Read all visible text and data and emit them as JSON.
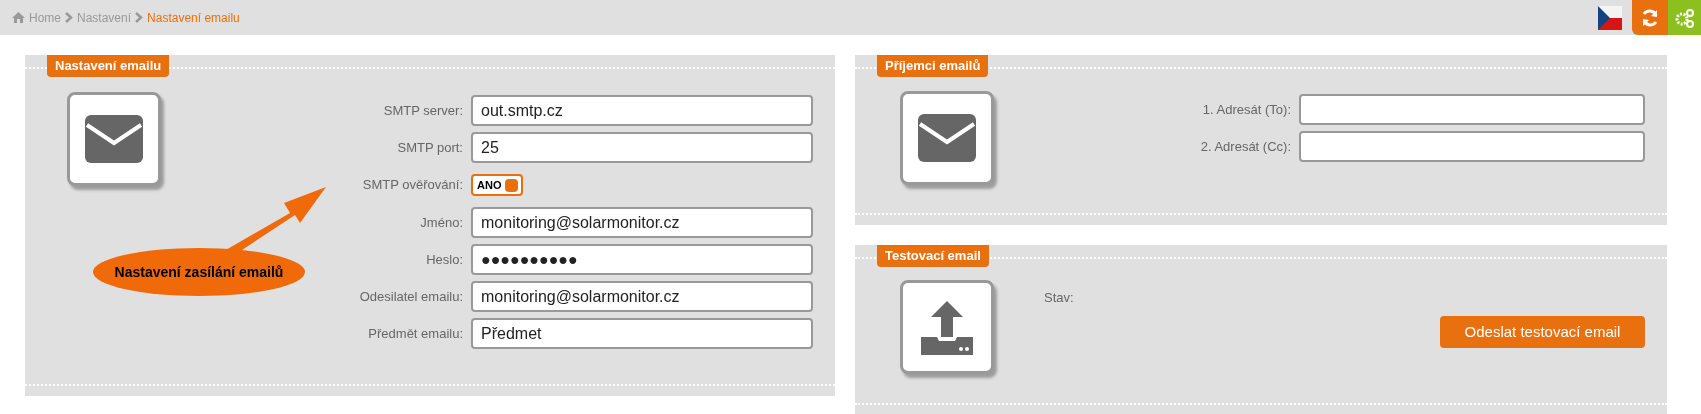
{
  "breadcrumb": [
    {
      "label": "Home",
      "selected": false
    },
    {
      "label": "Nastavení",
      "selected": false
    },
    {
      "label": "Nastavení emailu",
      "selected": true
    }
  ],
  "email_settings": {
    "title": "Nastavení emailu",
    "fields": [
      {
        "kind": "text",
        "label": "SMTP server:",
        "value": "out.smtp.cz"
      },
      {
        "kind": "text",
        "label": "SMTP port:",
        "value": "25"
      },
      {
        "kind": "toggle",
        "label": "SMTP ověřování:",
        "value": "ANO",
        "on": true
      },
      {
        "kind": "text",
        "label": "Jméno:",
        "value": "monitoring@solarmonitor.cz"
      },
      {
        "kind": "password",
        "label": "Heslo:",
        "value": "●●●●●●●●●●"
      },
      {
        "kind": "text",
        "label": "Odesilatel emailu:",
        "value": "monitoring@solarmonitor.cz"
      },
      {
        "kind": "text",
        "label": "Předmět emailu:",
        "value": "Předmet"
      }
    ],
    "callout": "Nastavení zasílání emailů"
  },
  "recipients": {
    "title": "Příjemci emailů",
    "fields": [
      {
        "kind": "text",
        "label": "1. Adresát (To):"
      },
      {
        "kind": "text",
        "label": "2. Adresát (Cc):"
      }
    ]
  },
  "test_email": {
    "title": "Testovací email",
    "status_label": "Stav:",
    "button": "Odeslat testovací email"
  }
}
